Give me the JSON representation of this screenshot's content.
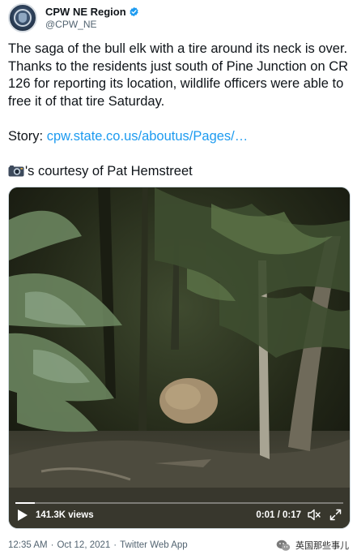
{
  "header": {
    "display_name": "CPW NE Region",
    "handle": "@CPW_NE",
    "avatar": "agency-badge-avatar",
    "verified_color": "#1d9bf0"
  },
  "tweet": {
    "text": "The saga of the bull elk with a tire around its neck is over. Thanks to the residents just south of Pine Junction on CR 126 for reporting its location, wildlife officers were able to free it of that tire Saturday.",
    "story_label": "Story: ",
    "story_link": "cpw.state.co.us/aboutus/Pages/…",
    "credit_icon": "camera-icon",
    "credit_text": "'s courtesy of Pat Hemstreet",
    "link_color": "#1d9bf0"
  },
  "video": {
    "views": "141.3K views",
    "time": "0:01 / 0:17",
    "progress": 0.06,
    "icons": [
      "play-icon",
      "volume-icon",
      "fullscreen-icon"
    ]
  },
  "meta": {
    "time": "12:35 AM",
    "sep1": "·",
    "date": "Oct 12, 2021",
    "sep2": "·",
    "source": "Twitter Web App"
  },
  "watermark": {
    "text": "英国那些事儿",
    "icon": "wechat-icon"
  }
}
